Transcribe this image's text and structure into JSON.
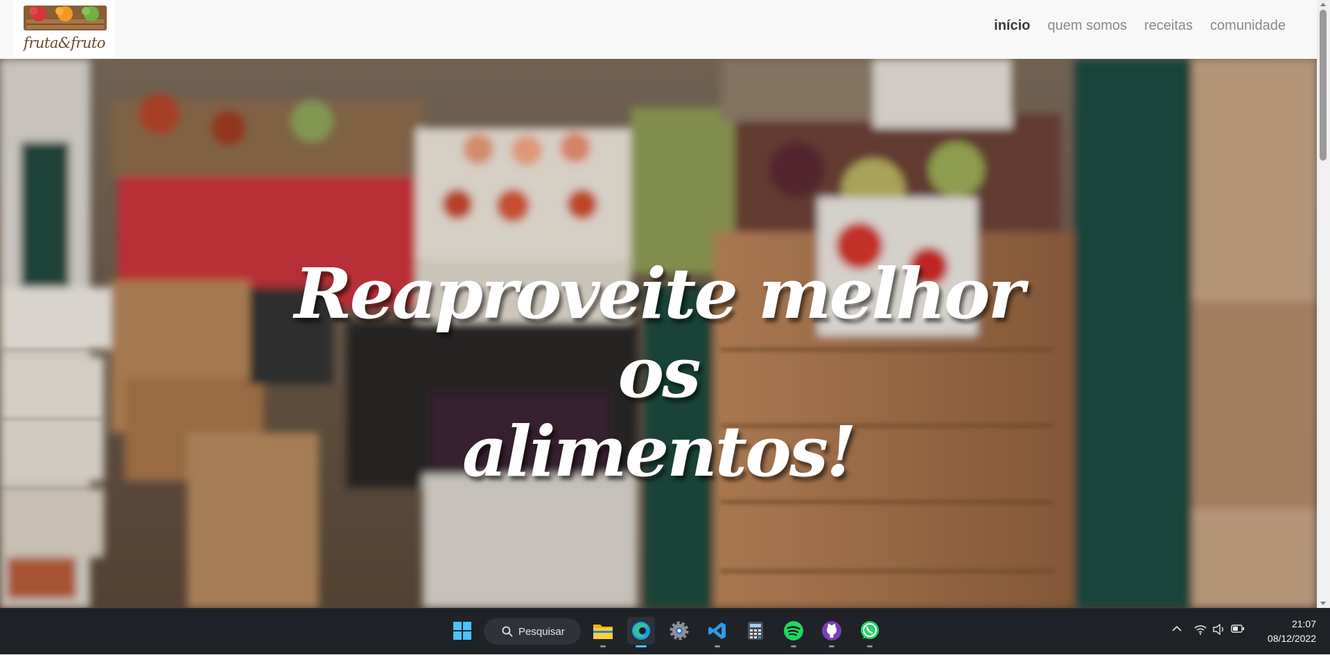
{
  "brand": {
    "logo_text": "fruta&fruto"
  },
  "nav": {
    "items": [
      {
        "label": "início",
        "active": true
      },
      {
        "label": "quem somos",
        "active": false
      },
      {
        "label": "receitas",
        "active": false
      },
      {
        "label": "comunidade",
        "active": false
      }
    ]
  },
  "hero": {
    "title_line1": "Reaproveite melhor os",
    "title_line2": "alimentos!"
  },
  "taskbar": {
    "search_label": "Pesquisar",
    "apps": [
      "windows-start",
      "file-explorer",
      "edge",
      "settings",
      "vscode",
      "calculator",
      "spotify",
      "github-desktop",
      "whatsapp"
    ],
    "clock_time": "21:07",
    "clock_date": "08/12/2022"
  },
  "colors": {
    "nav_bg": "#f8f8f8",
    "nav_active": "#3a3a3a",
    "nav_inactive": "#8a8a8a",
    "hero_text": "#ffffff",
    "taskbar_bg": "#1f2227",
    "accent": "#4cc2ff"
  }
}
